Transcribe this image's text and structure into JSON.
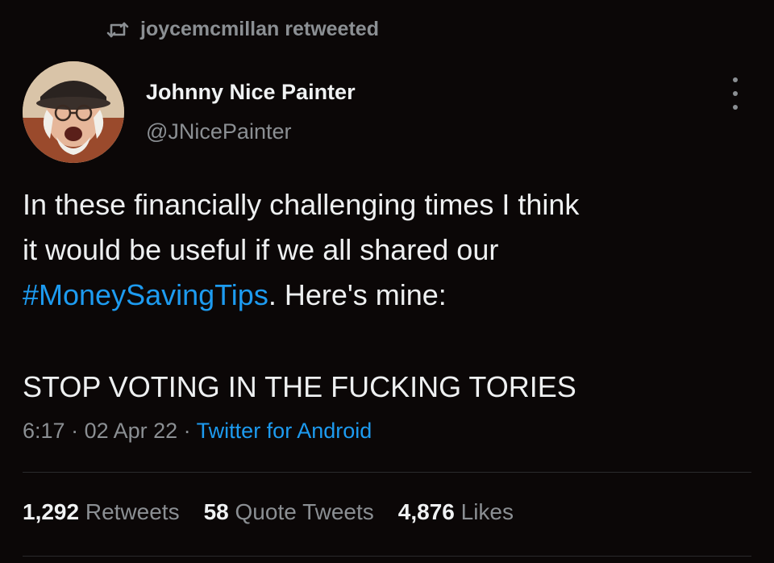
{
  "retweet": {
    "icon": "retweet-icon",
    "text": "joycemcmillan retweeted"
  },
  "author": {
    "name": "Johnny Nice Painter",
    "handle": "@JNicePainter",
    "avatar_icon": "avatar"
  },
  "tweet": {
    "lines": [
      "In these financially challenging times I think",
      "it would be useful if we all shared our"
    ],
    "hashtag": "#MoneySavingTips",
    "after_hashtag": ". Here's mine:",
    "shout": "STOP VOTING IN THE FUCKING TORIES"
  },
  "meta": {
    "time": "6:17",
    "sep1": " · ",
    "date": "02 Apr 22",
    "sep2": " · ",
    "source": "Twitter for Android"
  },
  "stats": {
    "retweets_count": "1,292",
    "retweets_label": "Retweets",
    "quotes_count": "58",
    "quotes_label": "Quote Tweets",
    "likes_count": "4,876",
    "likes_label": "Likes"
  },
  "colors": {
    "background": "#0b0707",
    "text": "#eef0f1",
    "secondary": "#8b8f93",
    "link": "#1d9bf0"
  }
}
